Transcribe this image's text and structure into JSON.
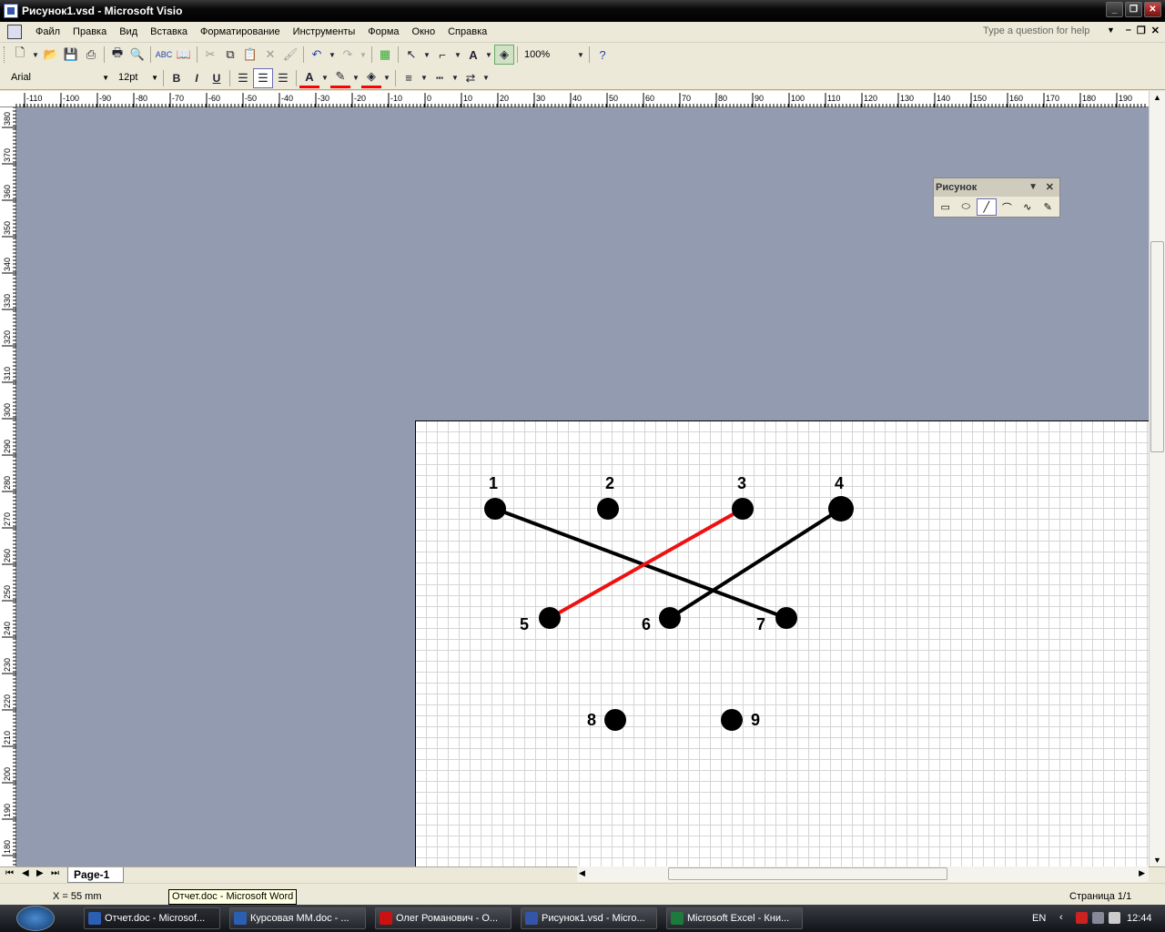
{
  "window": {
    "title": "Рисунок1.vsd - Microsoft Visio"
  },
  "menu": {
    "items": [
      "Файл",
      "Правка",
      "Вид",
      "Вставка",
      "Форматирование",
      "Инструменты",
      "Форма",
      "Окно",
      "Справка"
    ]
  },
  "help": {
    "placeholder": "Type a question for help"
  },
  "toolbar": {
    "zoom": "100%"
  },
  "format": {
    "font": "Arial",
    "size": "12pt",
    "bold": "B",
    "italic": "I",
    "underline": "U"
  },
  "colors": {
    "text": "#ff0000",
    "line": "#000000",
    "fill": "#ff0000",
    "highlight_line": "#ee1111"
  },
  "ruler": {
    "h_ticks": [
      "-110",
      "-100",
      "-90",
      "-80",
      "-70",
      "-60",
      "-50",
      "-40",
      "-30",
      "-20",
      "-10",
      "0",
      "10",
      "20",
      "30",
      "40",
      "50",
      "60",
      "70",
      "80",
      "90",
      "100",
      "110",
      "120",
      "130",
      "140",
      "150",
      "160",
      "170",
      "180",
      "190"
    ],
    "v_ticks": [
      "380",
      "370",
      "360",
      "350",
      "340",
      "330",
      "320",
      "310",
      "300",
      "290",
      "280",
      "270",
      "260",
      "250",
      "240",
      "230",
      "220",
      "210",
      "200",
      "190",
      "180"
    ]
  },
  "palette": {
    "title": "Рисунок"
  },
  "diagram": {
    "nodes": [
      {
        "id": "1",
        "label": "1"
      },
      {
        "id": "2",
        "label": "2"
      },
      {
        "id": "3",
        "label": "3"
      },
      {
        "id": "4",
        "label": "4"
      },
      {
        "id": "5",
        "label": "5"
      },
      {
        "id": "6",
        "label": "6"
      },
      {
        "id": "7",
        "label": "7"
      },
      {
        "id": "8",
        "label": "8"
      },
      {
        "id": "9",
        "label": "9"
      }
    ],
    "edges": [
      {
        "from": "1",
        "to": "7",
        "color": "#000000"
      },
      {
        "from": "3",
        "to": "5",
        "color": "#ee1111"
      },
      {
        "from": "4",
        "to": "6",
        "color": "#000000"
      }
    ]
  },
  "tabs": {
    "page": "Page-1"
  },
  "status": {
    "coords": "X = 55 mm",
    "page": "Страница 1/1"
  },
  "tooltip": {
    "text": "Отчет.doc - Microsoft Word"
  },
  "taskbar": {
    "items": [
      {
        "label": "Отчет.doc - Microsof...",
        "icon": "word-icon",
        "color": "#2b5fb4"
      },
      {
        "label": "Курсовая ММ.doc - ...",
        "icon": "word-icon",
        "color": "#2b5fb4"
      },
      {
        "label": "Олег Романович - О...",
        "icon": "opera-icon",
        "color": "#cc1111"
      },
      {
        "label": "Рисунок1.vsd - Micro...",
        "icon": "visio-icon",
        "color": "#3355aa"
      },
      {
        "label": "Microsoft Excel - Кни...",
        "icon": "excel-icon",
        "color": "#1e7a3c"
      }
    ],
    "lang": "EN",
    "time": "12:44"
  }
}
